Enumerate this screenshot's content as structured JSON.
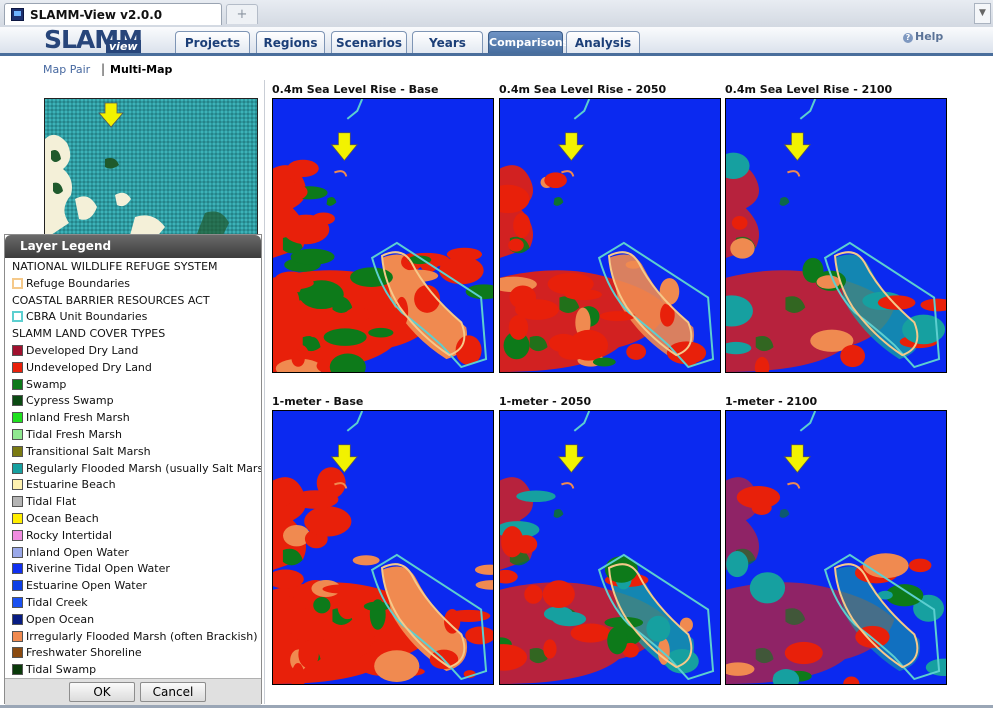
{
  "browser": {
    "tab_title": "SLAMM-View v2.0.0",
    "new_tab_glyph": "+",
    "scroll_glyph": "▼"
  },
  "logo": {
    "main": "SLAMM",
    "sub": "view"
  },
  "nav": {
    "tabs": [
      {
        "label": "Projects",
        "active": false
      },
      {
        "label": "Regions",
        "active": false
      },
      {
        "label": "Scenarios",
        "active": false
      },
      {
        "label": "Years",
        "active": false
      },
      {
        "label": "Comparisons",
        "active": true
      },
      {
        "label": "Analysis",
        "active": false
      }
    ],
    "help_label": "Help"
  },
  "submenu": {
    "map_pair": "Map Pair",
    "separator": "|",
    "multi_map": "Multi-Map"
  },
  "legend": {
    "title": "Layer Legend",
    "rows": [
      {
        "type": "heading",
        "label": "NATIONAL WILDLIFE REFUGE SYSTEM"
      },
      {
        "type": "outline",
        "label": "Refuge Boundaries",
        "color": "#f5c98a"
      },
      {
        "type": "heading",
        "label": "COASTAL BARRIER RESOURCES ACT"
      },
      {
        "type": "outline",
        "label": "CBRA Unit Boundaries",
        "color": "#5ccfd0"
      },
      {
        "type": "heading",
        "label": "SLAMM LAND COVER TYPES"
      },
      {
        "type": "fill",
        "label": "Developed Dry Land",
        "color": "#a0112e"
      },
      {
        "type": "fill",
        "label": "Undeveloped Dry Land",
        "color": "#e8200a"
      },
      {
        "type": "fill",
        "label": "Swamp",
        "color": "#0d7a1a"
      },
      {
        "type": "fill",
        "label": "Cypress Swamp",
        "color": "#0a4a12"
      },
      {
        "type": "fill",
        "label": "Inland Fresh Marsh",
        "color": "#1ee01e"
      },
      {
        "type": "fill",
        "label": "Tidal Fresh Marsh",
        "color": "#90e890"
      },
      {
        "type": "fill",
        "label": "Transitional Salt Marsh",
        "color": "#7a7a12"
      },
      {
        "type": "fill",
        "label": "Regularly Flooded Marsh (usually Salt Marsh)",
        "color": "#16a0a0"
      },
      {
        "type": "fill",
        "label": "Estuarine Beach",
        "color": "#fff2b0"
      },
      {
        "type": "fill",
        "label": "Tidal Flat",
        "color": "#b4b4b4"
      },
      {
        "type": "fill",
        "label": "Ocean Beach",
        "color": "#ffee00"
      },
      {
        "type": "fill",
        "label": "Rocky Intertidal",
        "color": "#f08ce0"
      },
      {
        "type": "fill",
        "label": "Inland Open Water",
        "color": "#9aa8e8"
      },
      {
        "type": "fill",
        "label": "Riverine Tidal Open Water",
        "color": "#1030f0"
      },
      {
        "type": "fill",
        "label": "Estuarine Open Water",
        "color": "#0e40e6"
      },
      {
        "type": "fill",
        "label": "Tidal Creek",
        "color": "#1a50f0"
      },
      {
        "type": "fill",
        "label": "Open Ocean",
        "color": "#071c82"
      },
      {
        "type": "fill",
        "label": "Irregularly Flooded Marsh (often Brackish)",
        "color": "#f08a50"
      },
      {
        "type": "fill",
        "label": "Freshwater Shoreline",
        "color": "#8a4a10"
      },
      {
        "type": "fill",
        "label": "Tidal Swamp",
        "color": "#0a3a0a"
      }
    ],
    "ok_label": "OK",
    "cancel_label": "Cancel"
  },
  "maps": [
    {
      "title": "0.4m Sea Level Rise - Base",
      "loss": 0
    },
    {
      "title": "0.4m Sea Level Rise - 2050",
      "loss": 1
    },
    {
      "title": "0.4m Sea Level Rise - 2100",
      "loss": 2
    },
    {
      "title": "1-meter - Base",
      "loss": 0
    },
    {
      "title": "1-meter - 2050",
      "loss": 2
    },
    {
      "title": "1-meter - 2100",
      "loss": 3
    }
  ],
  "colors": {
    "water": "#0b29f0",
    "dryland": "#e8200a",
    "swamp": "#0d7a1a",
    "brackish": "#f08a50",
    "saltmarsh": "#16a0a0",
    "cbra": "#5ccfd0",
    "refuge": "#f5c98a",
    "marker": "#f2f200"
  }
}
